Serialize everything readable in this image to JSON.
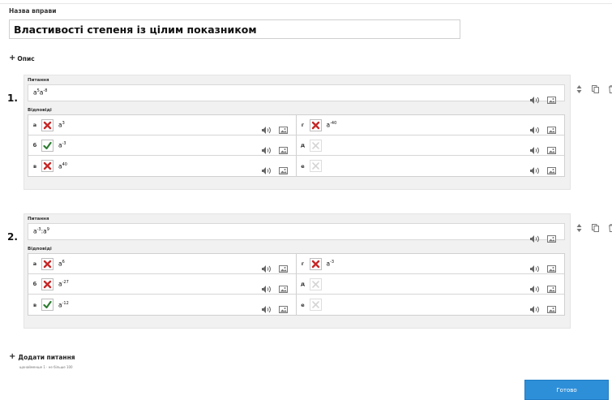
{
  "exercise": {
    "name_label": "Назва вправи",
    "name_value": "Властивості степеня із цілим показником"
  },
  "description_toggle": "Опис",
  "question_label": "Питання",
  "answers_label": "Відповіді",
  "questions": [
    {
      "number": "1.",
      "base": "a",
      "exp1": "5",
      "base2": "a",
      "exp2": "-8",
      "op": "",
      "answers": [
        {
          "letter": "а",
          "state": "wrong",
          "base": "a",
          "exp": "3"
        },
        {
          "letter": "б",
          "state": "correct",
          "base": "a",
          "exp": "-3"
        },
        {
          "letter": "в",
          "state": "wrong",
          "base": "a",
          "exp": "40"
        },
        {
          "letter": "г",
          "state": "wrong",
          "base": "a",
          "exp": "-40"
        },
        {
          "letter": "д",
          "state": "empty",
          "base": "",
          "exp": ""
        },
        {
          "letter": "е",
          "state": "empty",
          "base": "",
          "exp": ""
        }
      ]
    },
    {
      "number": "2.",
      "base": "a",
      "exp1": "-3",
      "base2": "a",
      "exp2": "9",
      "op": ":",
      "answers": [
        {
          "letter": "а",
          "state": "wrong",
          "base": "a",
          "exp": "6"
        },
        {
          "letter": "б",
          "state": "wrong",
          "base": "a",
          "exp": "-27"
        },
        {
          "letter": "в",
          "state": "correct",
          "base": "a",
          "exp": "-12"
        },
        {
          "letter": "г",
          "state": "wrong",
          "base": "a",
          "exp": "-3"
        },
        {
          "letter": "д",
          "state": "empty",
          "base": "",
          "exp": ""
        },
        {
          "letter": "е",
          "state": "empty",
          "base": "",
          "exp": ""
        }
      ]
    }
  ],
  "add_question": "Додати питання",
  "limits_hint": "щонайменше 1 · не більше 100",
  "done_button": "Готово",
  "colors": {
    "accent": "#2e8fd9",
    "wrong": "#c62828",
    "correct": "#2e7d32",
    "icon": "#666666"
  }
}
